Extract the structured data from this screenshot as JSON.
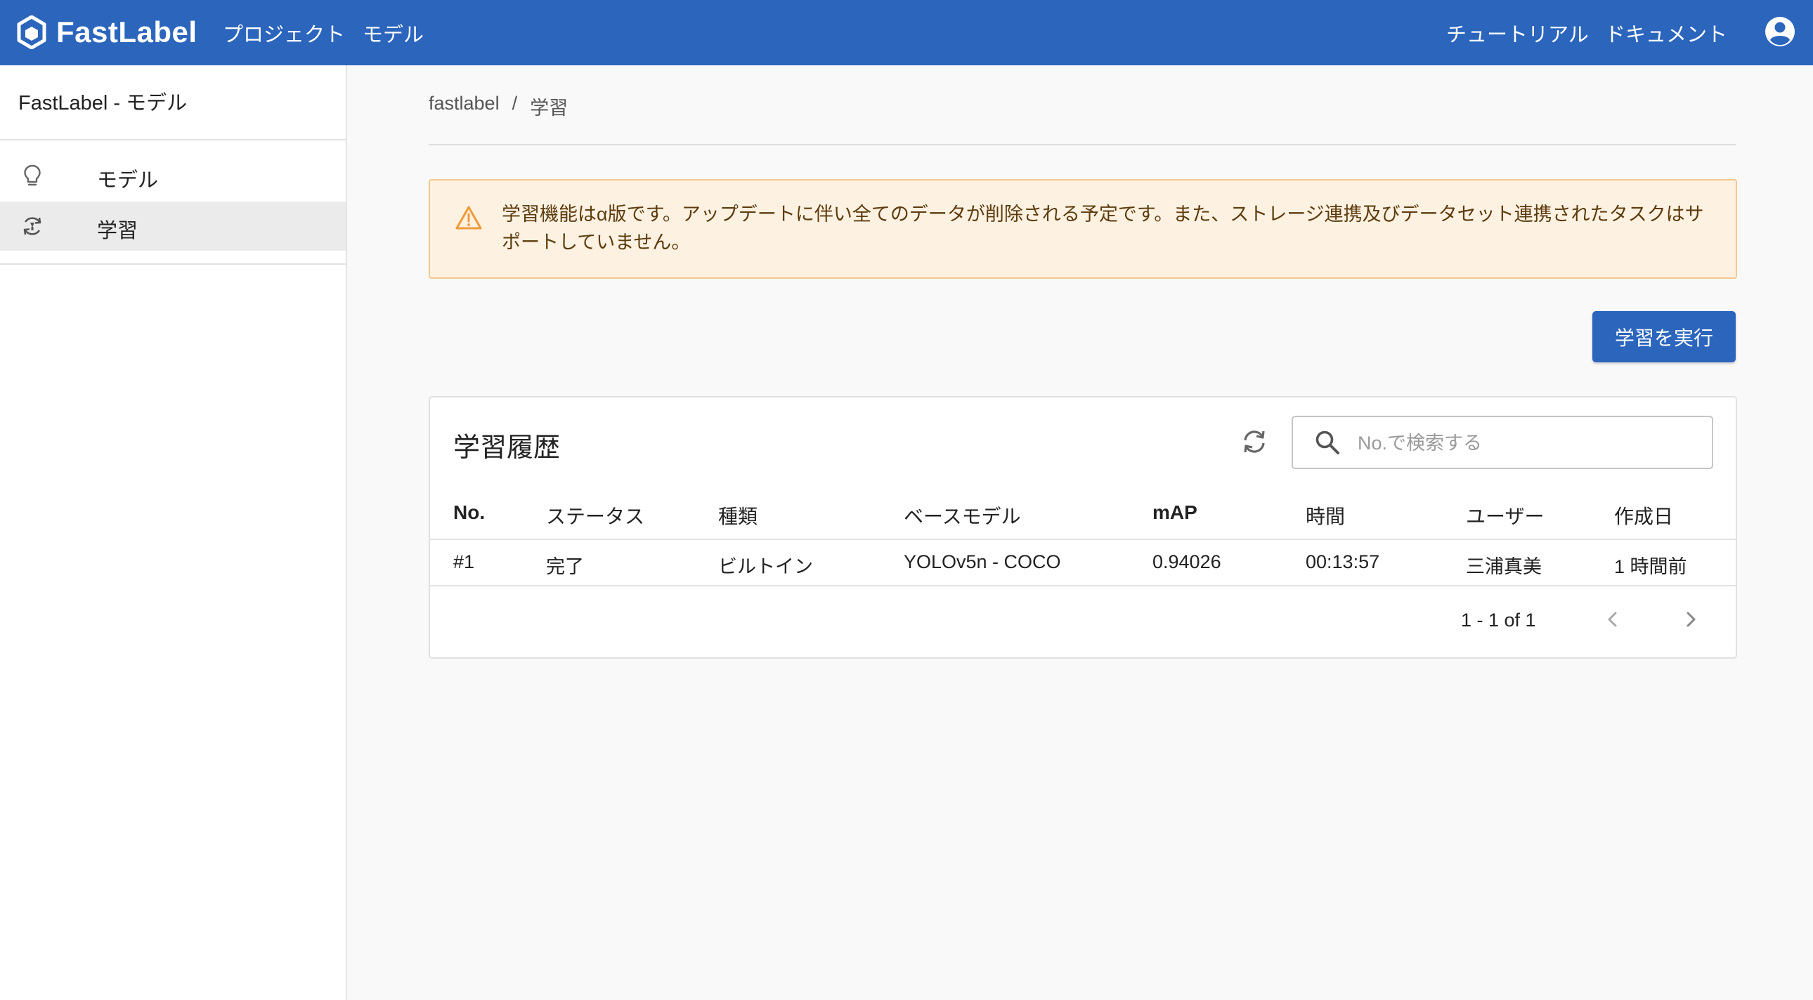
{
  "header": {
    "logo_text": "FastLabel",
    "nav": [
      "プロジェクト",
      "モデル"
    ],
    "right_links": [
      "チュートリアル",
      "ドキュメント"
    ],
    "account_icon": "account-circle-icon",
    "color": "#2c65bc"
  },
  "sidebar": {
    "title": "FastLabel - モデル",
    "items": [
      {
        "label": "モデル",
        "icon": "lightbulb-icon",
        "active": false
      },
      {
        "label": "学習",
        "icon": "training-cycle-icon",
        "active": true
      }
    ]
  },
  "breadcrumb": {
    "root": "fastlabel",
    "separator": "/",
    "current": "学習"
  },
  "alert": {
    "icon": "warning-icon",
    "text": "学習機能はα版です。アップデートに伴い全てのデータが削除される予定です。また、ストレージ連携及びデータセット連携されたタスクはサポートしていません。"
  },
  "run_button": {
    "label": "学習を実行"
  },
  "history": {
    "title": "学習履歴",
    "refresh_icon": "refresh-icon",
    "search": {
      "placeholder": "No.で検索する",
      "value": ""
    },
    "columns": [
      "No.",
      "ステータス",
      "種類",
      "ベースモデル",
      "mAP",
      "時間",
      "ユーザー",
      "作成日"
    ],
    "rows": [
      [
        "#1",
        "完了",
        "ビルトイン",
        "YOLOv5n - COCO",
        "0.94026",
        "00:13:57",
        "三浦真美",
        "1 時間前"
      ]
    ],
    "pagination": {
      "text": "1 - 1 of 1"
    }
  }
}
